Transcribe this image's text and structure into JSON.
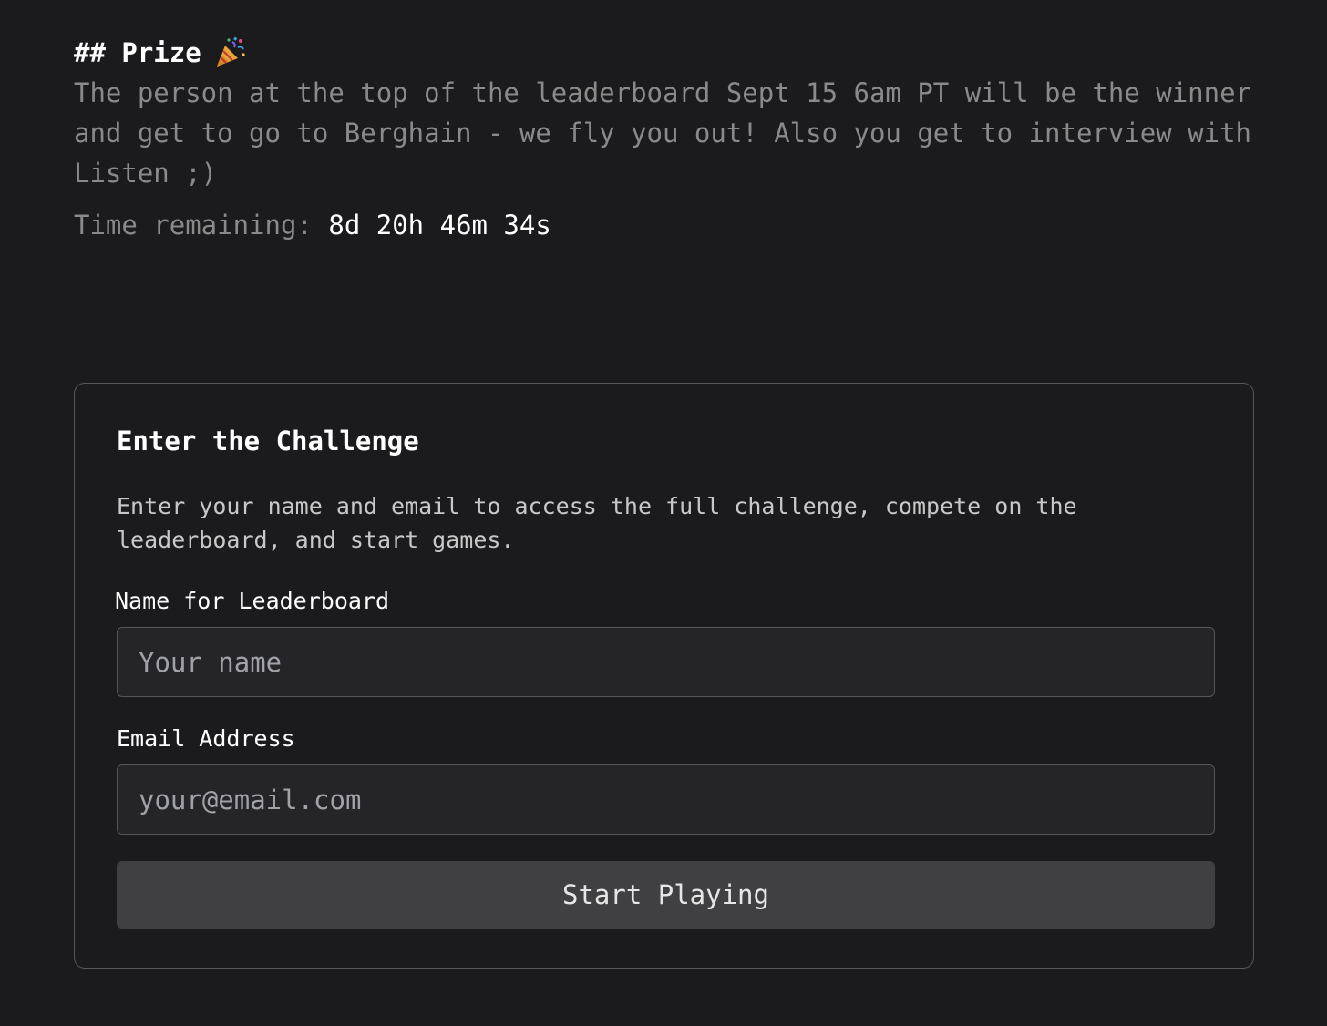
{
  "prize": {
    "heading": "## Prize",
    "icon": "party-popper-icon",
    "text": "The person at the top of the leaderboard Sept 15 6am PT will be the winner and get to go to Berghain - we fly you out! Also you get to interview with Listen ;)",
    "time_label": "Time remaining:",
    "time_value": "8d 20h 46m 34s"
  },
  "challenge": {
    "title": "Enter the Challenge",
    "description": "Enter your name and email to access the full challenge, compete on the leaderboard, and start games.",
    "name_label": "Name for Leaderboard",
    "name_placeholder": "Your name",
    "name_value": "",
    "email_label": "Email Address",
    "email_placeholder": "your@email.com",
    "email_value": "",
    "submit_label": "Start Playing"
  },
  "colors": {
    "background": "#1b1b1d",
    "muted_text": "#8a8a8a",
    "input_background": "#252527",
    "button_background": "#404042"
  }
}
